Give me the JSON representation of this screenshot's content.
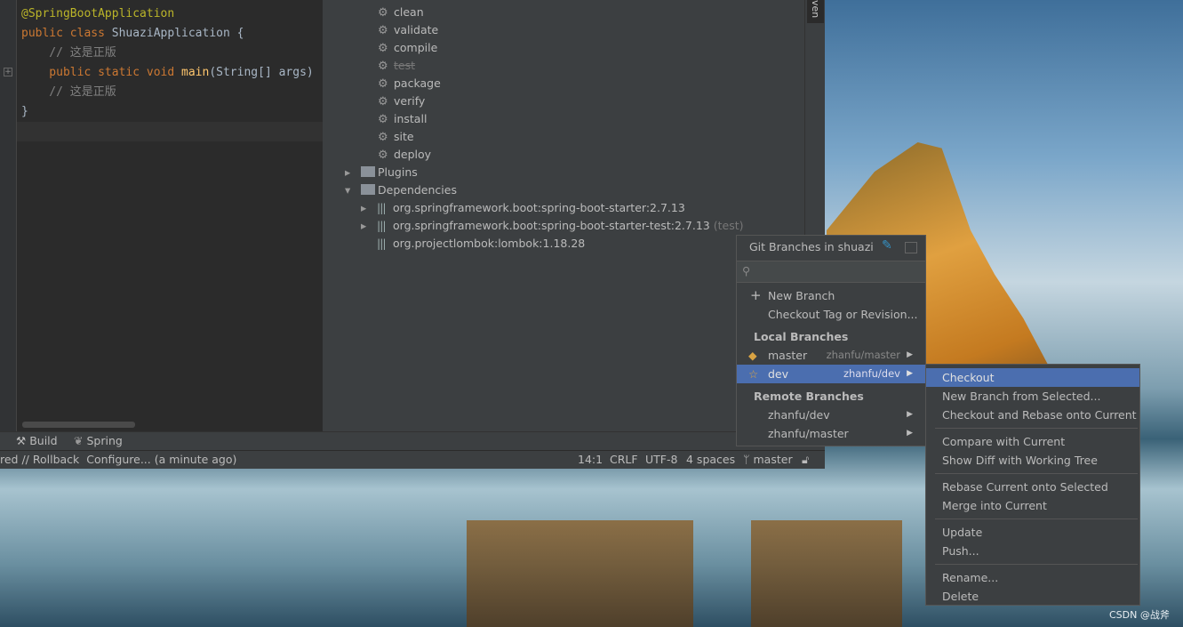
{
  "editor": {
    "lines": [
      {
        "parts": [
          {
            "c": "ann",
            "t": "@SpringBootApplication"
          }
        ]
      },
      {
        "parts": [
          {
            "c": "kw",
            "t": "public class "
          },
          {
            "c": "tx",
            "t": "ShuaziApplication {"
          }
        ]
      },
      {
        "parts": [
          {
            "c": "cm",
            "t": "    // 这是正版"
          }
        ]
      },
      {
        "parts": [
          {
            "c": "kw",
            "t": "    public static void "
          },
          {
            "c": "fn",
            "t": "main"
          },
          {
            "c": "tx",
            "t": "(String[] args)"
          }
        ]
      },
      {
        "parts": [
          {
            "c": "cm",
            "t": "    // 这是正版"
          }
        ]
      },
      {
        "parts": [
          {
            "c": "tx",
            "t": "}"
          }
        ]
      }
    ]
  },
  "maven": {
    "lifecycle": [
      {
        "label": "clean",
        "disabled": false
      },
      {
        "label": "validate",
        "disabled": false
      },
      {
        "label": "compile",
        "disabled": false
      },
      {
        "label": "test",
        "disabled": true
      },
      {
        "label": "package",
        "disabled": false
      },
      {
        "label": "verify",
        "disabled": false
      },
      {
        "label": "install",
        "disabled": false
      },
      {
        "label": "site",
        "disabled": false
      },
      {
        "label": "deploy",
        "disabled": false
      }
    ],
    "plugins": "Plugins",
    "dependencies": "Dependencies",
    "deps": [
      {
        "label": "org.springframework.boot:spring-boot-starter:2.7.13",
        "scope": "",
        "expandable": true
      },
      {
        "label": "org.springframework.boot:spring-boot-starter-test:2.7.13",
        "scope": "(test)",
        "expandable": true
      },
      {
        "label": "org.projectlombok:lombok:1.18.28",
        "scope": "",
        "expandable": false
      }
    ],
    "side_tab": "ven"
  },
  "toolwindows": {
    "build": "Build",
    "spring": "Spring"
  },
  "status": {
    "message": "red // Rollback  Configure... (a minute ago)",
    "position": "14:1",
    "line_sep": "CRLF",
    "encoding": "UTF-8",
    "indent": "4 spaces",
    "branch": "master"
  },
  "popup": {
    "title": "Git Branches in shuazi",
    "search_placeholder": "",
    "new_branch": "New Branch",
    "checkout_tag": "Checkout Tag or Revision...",
    "local_header": "Local Branches",
    "local": [
      {
        "name": "master",
        "tracking": "zhanfu/master",
        "icon": "tag-icon",
        "selected": false
      },
      {
        "name": "dev",
        "tracking": "zhanfu/dev",
        "icon": "star-icon",
        "selected": true
      }
    ],
    "remote_header": "Remote Branches",
    "remote": [
      {
        "name": "zhanfu/dev"
      },
      {
        "name": "zhanfu/master"
      }
    ]
  },
  "submenu": {
    "groups": [
      [
        "Checkout",
        "New Branch from Selected...",
        "Checkout and Rebase onto Current"
      ],
      [
        "Compare with Current",
        "Show Diff with Working Tree"
      ],
      [
        "Rebase Current onto Selected",
        "Merge into Current"
      ],
      [
        "Update",
        "Push..."
      ],
      [
        "Rename...",
        "Delete"
      ]
    ],
    "selected": "Checkout"
  },
  "watermark": "CSDN @战斧",
  "colors": {
    "accent": "#4b6eaf",
    "panel": "#3c3f41",
    "editor": "#2b2b2b"
  }
}
